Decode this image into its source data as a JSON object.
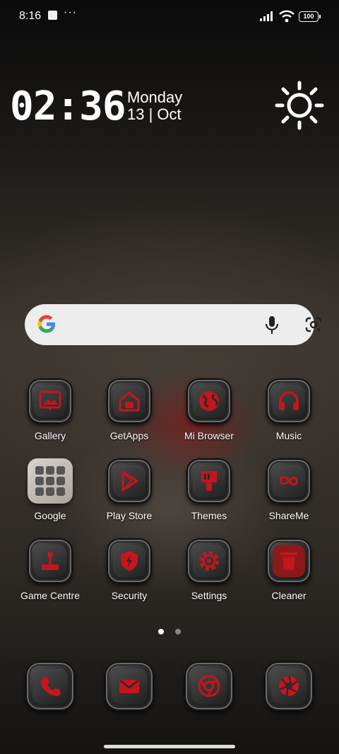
{
  "status_bar": {
    "time": "8:16",
    "dots": "···",
    "battery": "100"
  },
  "clock_widget": {
    "time": "02:36",
    "day": "Monday",
    "date": "13 | Oct"
  },
  "search_bar": {
    "google_icon": "google-icon",
    "mic_icon": "mic-icon",
    "lens_icon": "google-lens-icon"
  },
  "apps": [
    {
      "label": "Gallery",
      "icon": "gallery-icon"
    },
    {
      "label": "GetApps",
      "icon": "getapps-icon"
    },
    {
      "label": "Mi Browser",
      "icon": "globe-icon"
    },
    {
      "label": "Music",
      "icon": "headphones-icon"
    },
    {
      "label": "Google",
      "icon": "google-folder-icon"
    },
    {
      "label": "Play Store",
      "icon": "play-store-icon"
    },
    {
      "label": "Themes",
      "icon": "paint-brush-icon"
    },
    {
      "label": "ShareMe",
      "icon": "infinity-icon"
    },
    {
      "label": "Game Centre",
      "icon": "joystick-icon"
    },
    {
      "label": "Security",
      "icon": "shield-bolt-icon"
    },
    {
      "label": "Settings",
      "icon": "gear-icon"
    },
    {
      "label": "Cleaner",
      "icon": "trash-icon"
    }
  ],
  "pager": {
    "pages": 2,
    "current": 1
  },
  "dock": [
    {
      "icon": "phone-icon"
    },
    {
      "icon": "mail-icon"
    },
    {
      "icon": "chrome-icon"
    },
    {
      "icon": "camera-shutter-icon"
    }
  ],
  "colors": {
    "accent": "#c4161c",
    "icon_dark": "#2a2a2a",
    "search_bg": "#ededed"
  }
}
